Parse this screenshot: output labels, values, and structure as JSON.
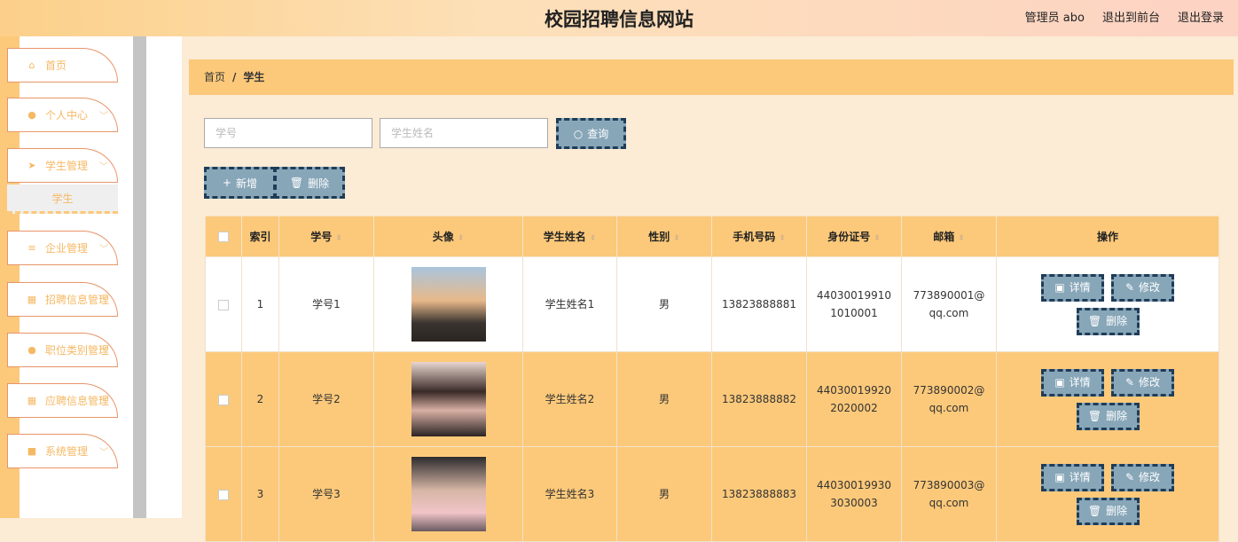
{
  "header": {
    "title": "校园招聘信息网站",
    "user": "管理员 abo",
    "to_front": "退出到前台",
    "logout": "退出登录"
  },
  "sidebar": {
    "items": [
      {
        "label": "首页",
        "icon": "home-icon",
        "glyph": "⌂",
        "chev": false
      },
      {
        "label": "个人中心",
        "icon": "user-icon",
        "glyph": "●",
        "chev": true
      },
      {
        "label": "学生管理",
        "icon": "paper-plane-icon",
        "glyph": "➤",
        "chev": true
      },
      {
        "label": "企业管理",
        "icon": "sliders-icon",
        "glyph": "≡",
        "chev": true
      },
      {
        "label": "招聘信息管理",
        "icon": "grid-icon",
        "glyph": "▦",
        "chev": true
      },
      {
        "label": "职位类别管理",
        "icon": "pin-icon",
        "glyph": "●",
        "chev": true
      },
      {
        "label": "应聘信息管理",
        "icon": "grid-icon",
        "glyph": "▦",
        "chev": true
      },
      {
        "label": "系统管理",
        "icon": "settings-icon",
        "glyph": "■",
        "chev": true
      }
    ],
    "sub_item": "学生"
  },
  "breadcrumb": {
    "home": "首页",
    "sep": "/",
    "current": "学生"
  },
  "search": {
    "id_placeholder": "学号",
    "name_placeholder": "学生姓名",
    "query": "查询"
  },
  "actions": {
    "add": "新增",
    "delete": "删除"
  },
  "table": {
    "headers": [
      "索引",
      "学号",
      "头像",
      "学生姓名",
      "性别",
      "手机号码",
      "身份证号",
      "邮箱",
      "操作"
    ],
    "rows": [
      {
        "index": "1",
        "id": "学号1",
        "name": "学生姓名1",
        "gender": "男",
        "phone": "13823888881",
        "idcard": "440300199101010001",
        "email": "773890001@qq.com"
      },
      {
        "index": "2",
        "id": "学号2",
        "name": "学生姓名2",
        "gender": "男",
        "phone": "13823888882",
        "idcard": "440300199202020002",
        "email": "773890002@qq.com"
      },
      {
        "index": "3",
        "id": "学号3",
        "name": "学生姓名3",
        "gender": "男",
        "phone": "13823888883",
        "idcard": "440300199303030003",
        "email": "773890003@qq.com"
      }
    ],
    "ops": {
      "detail": "详情",
      "edit": "修改",
      "delete": "删除"
    }
  },
  "colors": {
    "accent": "#fcc97a",
    "button": "#87a6b8",
    "button_border": "#1f3c58"
  }
}
